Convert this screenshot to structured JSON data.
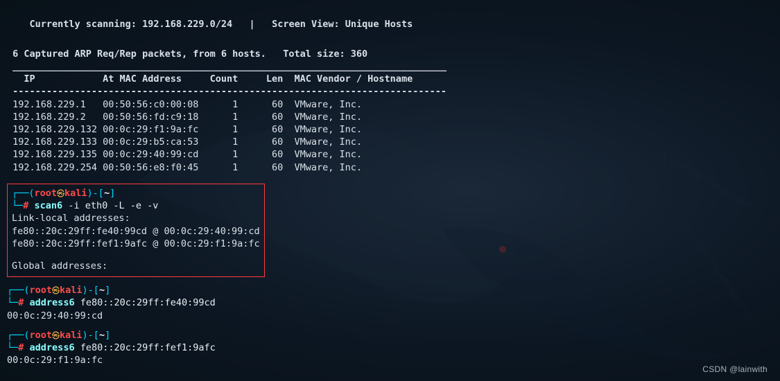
{
  "header": {
    "scanning_label": "Currently scanning:",
    "scanning_target": "192.168.229.0/24",
    "separator": "|",
    "view_label": "Screen View:",
    "view_value": "Unique Hosts",
    "captured_line": " 6 Captured ARP Req/Rep packets, from 6 hosts.   Total size: 360"
  },
  "table": {
    "rule": " _____________________________________________________________________________",
    "header": "   IP            At MAC Address     Count     Len  MAC Vendor / Hostname     ",
    "underline": " -----------------------------------------------------------------------------",
    "rows": [
      " 192.168.229.1   00:50:56:c0:00:08      1      60  VMware, Inc.",
      " 192.168.229.2   00:50:56:fd:c9:18      1      60  VMware, Inc.",
      " 192.168.229.132 00:0c:29:f1:9a:fc      1      60  VMware, Inc.",
      " 192.168.229.133 00:0c:29:b5:ca:53      1      60  VMware, Inc.",
      " 192.168.229.135 00:0c:29:40:99:cd      1      60  VMware, Inc.",
      " 192.168.229.254 00:50:56:e8:f0:45      1      60  VMware, Inc."
    ]
  },
  "prompt": {
    "open_top": "┌──(",
    "user": "root",
    "skull": "㉿",
    "host": "kali",
    "close_user_host": ")-[",
    "cwd": "~",
    "close_bracket": "]",
    "bottom_prefix": "└─",
    "hash": "#"
  },
  "block1": {
    "cmd": "scan6",
    "args_plain": " -i eth0 -L -e -v",
    "out1": "Link-local addresses:",
    "out2": "fe80::20c:29ff:fe40:99cd @ 00:0c:29:40:99:cd",
    "out3": "fe80::20c:29ff:fef1:9afc @ 00:0c:29:f1:9a:fc",
    "out4": "Global addresses:"
  },
  "block2": {
    "cmd": "address6",
    "arg": " fe80::20c:29ff:fe40:99cd",
    "out": "00:0c:29:40:99:cd"
  },
  "block3": {
    "cmd": "address6",
    "arg": " fe80::20c:29ff:fef1:9afc",
    "out": "00:0c:29:f1:9a:fc"
  },
  "watermark": "CSDN @lainwith"
}
